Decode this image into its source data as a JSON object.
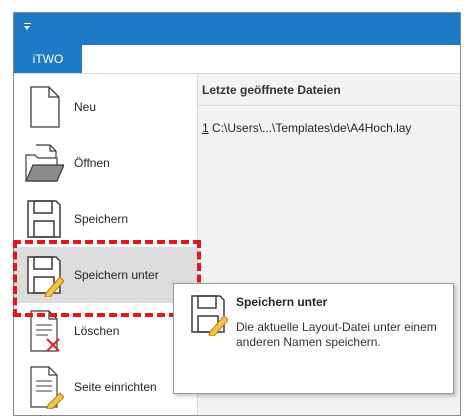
{
  "titlebar": {
    "color": "#1e79c6",
    "qat_icon": "customize-quick-access-icon"
  },
  "ribbon": {
    "file_tab_label": "iTWO"
  },
  "menu": {
    "items": [
      {
        "label": "Neu",
        "icon": "new-document-icon"
      },
      {
        "label": "Öffnen",
        "icon": "open-folder-icon"
      },
      {
        "label": "Speichern",
        "icon": "save-icon"
      },
      {
        "label": "Speichern unter",
        "icon": "save-as-icon"
      },
      {
        "label": "Löschen",
        "icon": "delete-document-icon"
      },
      {
        "label": "Seite einrichten",
        "icon": "page-setup-icon"
      }
    ]
  },
  "recent": {
    "header": "Letzte geöffnete Dateien",
    "files": [
      {
        "num": "1",
        "path": " C:\\Users\\...\\Templates\\de\\A4Hoch.lay"
      }
    ]
  },
  "tooltip": {
    "title": "Speichern unter",
    "text": "Die aktuelle Layout-Datei unter einem anderen Namen speichern.",
    "icon": "save-as-icon"
  },
  "annotation": {
    "color": "#e4161b"
  }
}
